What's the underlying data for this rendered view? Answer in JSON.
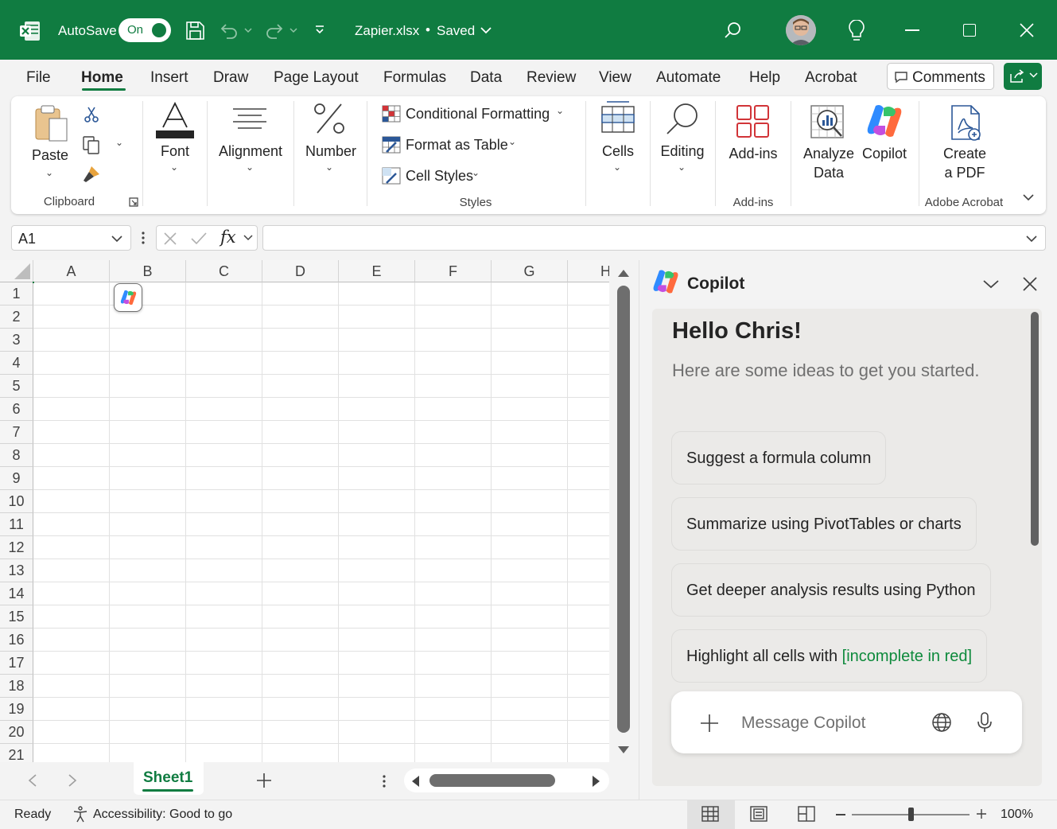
{
  "titlebar": {
    "autosave_label": "AutoSave",
    "autosave_state": "On",
    "document_title": "Zapier.xlsx",
    "save_status": "Saved"
  },
  "menu": {
    "tabs": [
      "File",
      "Home",
      "Insert",
      "Draw",
      "Page Layout",
      "Formulas",
      "Data",
      "Review",
      "View",
      "Automate",
      "Help",
      "Acrobat"
    ],
    "active_tab": "Home",
    "comments_label": "Comments"
  },
  "ribbon": {
    "paste": "Paste",
    "clipboard_group": "Clipboard",
    "font": "Font",
    "alignment": "Alignment",
    "number": "Number",
    "conditional_formatting": "Conditional Formatting",
    "format_as_table": "Format as Table",
    "cell_styles": "Cell Styles",
    "styles_group": "Styles",
    "cells": "Cells",
    "editing": "Editing",
    "addins": "Add-ins",
    "addins_group": "Add-ins",
    "analyze_line1": "Analyze",
    "analyze_line2": "Data",
    "copilot": "Copilot",
    "create_line1": "Create",
    "create_line2": "a PDF",
    "acrobat_group": "Adobe Acrobat"
  },
  "formula_bar": {
    "name_box": "A1",
    "fx_label": "fx",
    "formula_value": ""
  },
  "grid": {
    "columns": [
      "A",
      "B",
      "C",
      "D",
      "E",
      "F",
      "G",
      "H"
    ],
    "rows": [
      "1",
      "2",
      "3",
      "4",
      "5",
      "6",
      "7",
      "8",
      "9",
      "10",
      "11",
      "12",
      "13",
      "14",
      "15",
      "16",
      "17",
      "18",
      "19",
      "20",
      "21"
    ]
  },
  "sheets": {
    "tabs": [
      "Sheet1"
    ],
    "active": "Sheet1"
  },
  "status": {
    "ready": "Ready",
    "accessibility": "Accessibility: Good to go",
    "zoom": "100%"
  },
  "copilot": {
    "title": "Copilot",
    "greeting": "Hello Chris!",
    "subtitle": "Here are some ideas to get you started.",
    "suggestions": [
      {
        "text": "Suggest a formula column",
        "highlight": ""
      },
      {
        "text": "Summarize using PivotTables or charts",
        "highlight": ""
      },
      {
        "text": "Get deeper analysis results using Python",
        "highlight": ""
      },
      {
        "text": "Highlight all cells with ",
        "highlight": "[incomplete in red]"
      }
    ],
    "input_placeholder": "Message Copilot"
  },
  "colors": {
    "brand": "#107c41",
    "highlight_text": "#0e8a3c"
  }
}
